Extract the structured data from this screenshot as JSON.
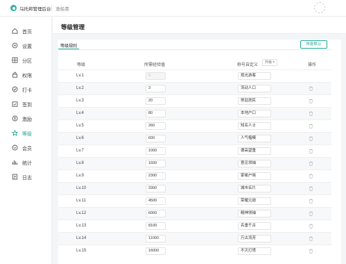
{
  "app": {
    "title": "乌托邦管理后台",
    "user": "渔船港"
  },
  "sidebar": {
    "items": [
      {
        "label": "首页",
        "icon": "home-icon"
      },
      {
        "label": "设置",
        "icon": "settings-icon"
      },
      {
        "label": "分区",
        "icon": "grid-icon"
      },
      {
        "label": "权限",
        "icon": "lock-icon"
      },
      {
        "label": "打卡",
        "icon": "check-circle-icon"
      },
      {
        "label": "签到",
        "icon": "calendar-check-icon"
      },
      {
        "label": "激励",
        "icon": "coin-icon"
      },
      {
        "label": "等级",
        "icon": "star-icon"
      },
      {
        "label": "会员",
        "icon": "member-icon"
      },
      {
        "label": "统计",
        "icon": "bar-chart-icon"
      },
      {
        "label": "日志",
        "icon": "document-icon"
      }
    ],
    "active_index": 7,
    "accent_color": "#22a896"
  },
  "page": {
    "title": "等级管理"
  },
  "tabs": {
    "active": "等级规则"
  },
  "toolbar": {
    "restore_label": "恢复默认"
  },
  "table": {
    "headers": {
      "level": "等级",
      "exp": "所需经验值",
      "name": "称号自定义",
      "action": "操作"
    },
    "sort_select": "升级",
    "rows": [
      {
        "level": "Lv.1",
        "exp": "0",
        "name": "观光游客",
        "exp_disabled": true
      },
      {
        "level": "Lv.2",
        "exp": "3",
        "name": "流动人口"
      },
      {
        "level": "Lv.3",
        "exp": "20",
        "name": "常驻居民"
      },
      {
        "level": "Lv.4",
        "exp": "80",
        "name": "本地户口"
      },
      {
        "level": "Lv.5",
        "exp": "260",
        "name": "知名人士"
      },
      {
        "level": "Lv.6",
        "exp": "600",
        "name": "人气楷模"
      },
      {
        "level": "Lv.7",
        "exp": "1000",
        "name": "德高望重"
      },
      {
        "level": "Lv.8",
        "exp": "1600",
        "name": "意见领袖"
      },
      {
        "level": "Lv.9",
        "exp": "2300",
        "name": "家喻户晓"
      },
      {
        "level": "Lv.10",
        "exp": "3300",
        "name": "城市名片"
      },
      {
        "level": "Lv.11",
        "exp": "4500",
        "name": "荣耀元勋"
      },
      {
        "level": "Lv.12",
        "exp": "6000",
        "name": "精神领袖"
      },
      {
        "level": "Lv.13",
        "exp": "8100",
        "name": "名垂千古"
      },
      {
        "level": "Lv.14",
        "exp": "11000",
        "name": "万古流芳"
      },
      {
        "level": "Lv.15",
        "exp": "16000",
        "name": "不灭灯塔"
      }
    ]
  }
}
